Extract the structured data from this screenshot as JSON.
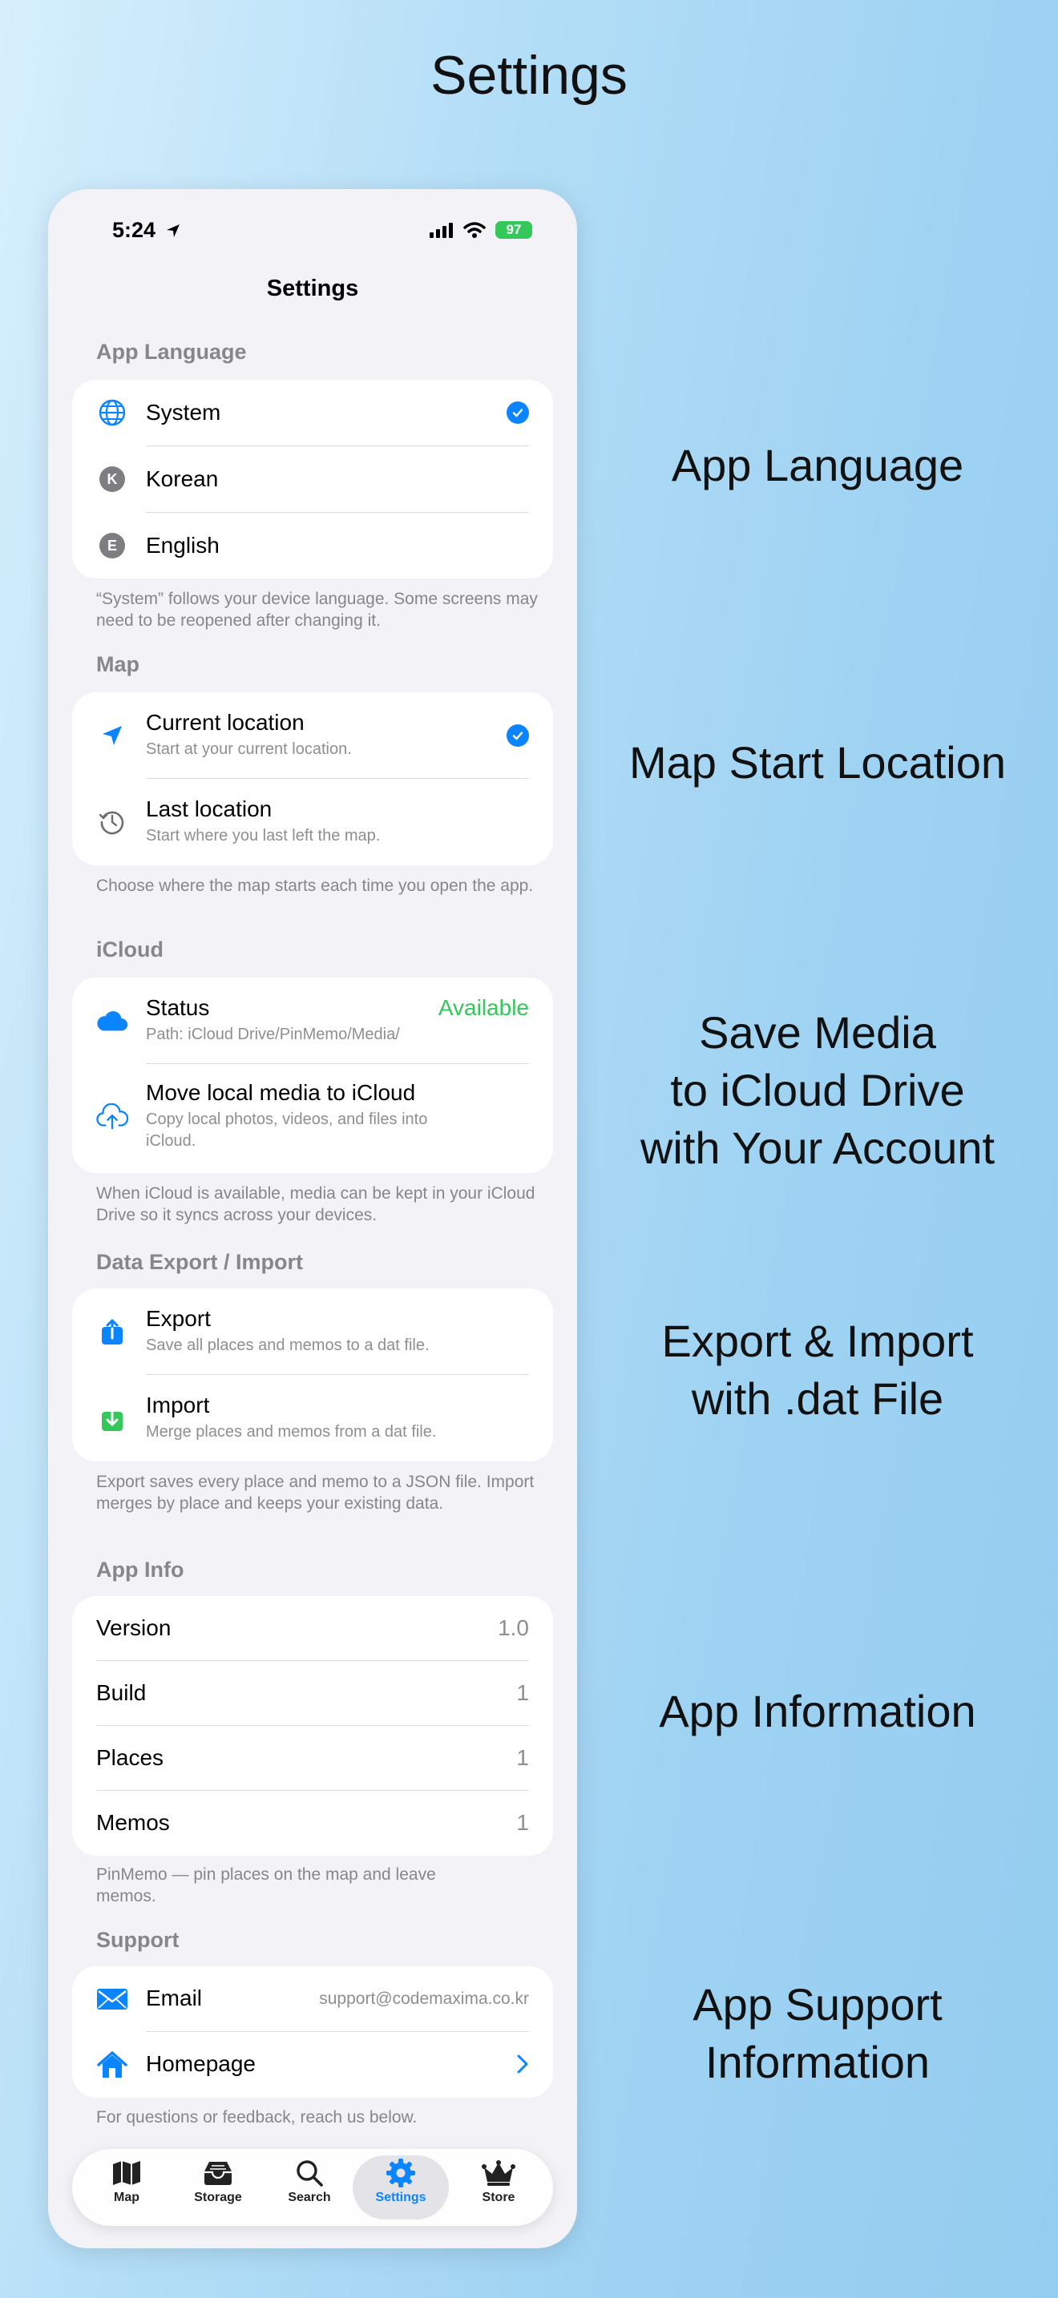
{
  "page_title": "Settings",
  "captions": {
    "language": "App Language",
    "map": "Map Start Location",
    "icloud": "Save Media\nto iCloud Drive\nwith Your Account",
    "export": "Export & Import\nwith .dat File",
    "info": "App Information",
    "support": "App Support\nInformation"
  },
  "status_bar": {
    "time": "5:24",
    "battery": "97"
  },
  "nav_title": "Settings",
  "language": {
    "header": "App Language",
    "items": [
      {
        "label": "System",
        "selected": true
      },
      {
        "label": "Korean",
        "badge": "K"
      },
      {
        "label": "English",
        "badge": "E"
      }
    ],
    "footer": "“System” follows your device language. Some screens may need to be reopened after changing it."
  },
  "map": {
    "header": "Map",
    "items": [
      {
        "label": "Current location",
        "sub": "Start at your current location.",
        "selected": true
      },
      {
        "label": "Last location",
        "sub": "Start where you last left the map."
      }
    ],
    "footer": "Choose where the map starts each time you open the app."
  },
  "icloud": {
    "header": "iCloud",
    "status_label": "Status",
    "status_value": "Available",
    "status_sub": "Path: iCloud Drive/PinMemo/Media/",
    "move_label": "Move local media to iCloud",
    "move_sub": "Copy local photos, videos, and files into iCloud.",
    "footer": "When iCloud is available, media can be kept in your iCloud Drive so it syncs across your devices."
  },
  "data": {
    "header": "Data Export / Import",
    "export_label": "Export",
    "export_sub": "Save all places and memos to a dat file.",
    "import_label": "Import",
    "import_sub": "Merge places and memos from a dat file.",
    "footer": "Export saves every place and memo to a JSON file. Import merges by place and keeps your existing data."
  },
  "app_info": {
    "header": "App Info",
    "rows": [
      {
        "label": "Version",
        "value": "1.0"
      },
      {
        "label": "Build",
        "value": "1"
      },
      {
        "label": "Places",
        "value": "1"
      },
      {
        "label": "Memos",
        "value": "1"
      }
    ],
    "footer": "PinMemo — pin places on the map and leave memos."
  },
  "support": {
    "header": "Support",
    "email_label": "Email",
    "email_value": "support@codemaxima.co.kr",
    "homepage_label": "Homepage",
    "footer": "For questions or feedback, reach us below."
  },
  "tabs": [
    {
      "label": "Map",
      "icon": "map-icon"
    },
    {
      "label": "Storage",
      "icon": "tray-icon"
    },
    {
      "label": "Search",
      "icon": "search-icon"
    },
    {
      "label": "Settings",
      "icon": "gear-icon",
      "active": true
    },
    {
      "label": "Store",
      "icon": "crown-icon"
    }
  ],
  "colors": {
    "accent": "#0a84ff",
    "available": "#34c759",
    "export_icon": "#0a84ff",
    "import_icon": "#34c759"
  }
}
